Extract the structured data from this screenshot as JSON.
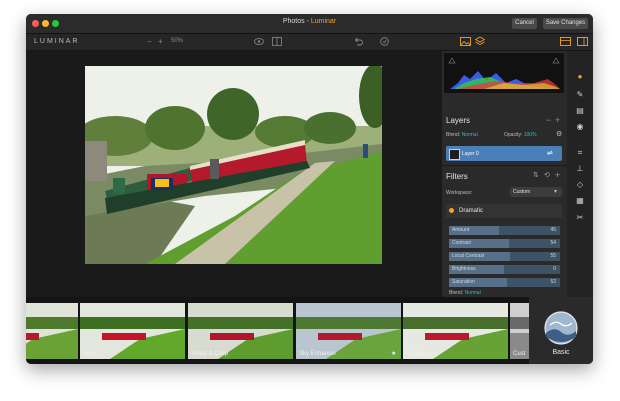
{
  "window": {
    "title_prefix": "Photos - ",
    "title_app": "Luminar",
    "cancel_label": "Cancel",
    "save_label": "Save Changes",
    "traffic_colors": [
      "#ff5f57",
      "#febc2e",
      "#28c840"
    ]
  },
  "toolbar": {
    "logo": "LUMINAR",
    "zoom_minus": "−",
    "zoom_plus": "+",
    "zoom": "50%"
  },
  "layers": {
    "title": "Layers",
    "blend_label": "Blend:",
    "blend_value": "Normal",
    "opacity_label": "Opacity:",
    "opacity_value": "100%",
    "layer_name": "Layer 0"
  },
  "filters": {
    "title": "Filters",
    "workspace_label": "Workspace:",
    "workspace_value": "Custom",
    "filter_name": "Dramatic",
    "sliders": [
      {
        "label": "Amount",
        "value": "45",
        "fill": 0.45
      },
      {
        "label": "Contrast",
        "value": "54",
        "fill": 0.54
      },
      {
        "label": "Local Contrast",
        "value": "55",
        "fill": 0.55
      },
      {
        "label": "Brightness",
        "value": "0",
        "fill": 0.5
      },
      {
        "label": "Saturation",
        "value": "52",
        "fill": 0.52
      }
    ],
    "blend_label": "Blend:",
    "blend_value": "Normal"
  },
  "presets": {
    "items": [
      {
        "label": "nces"
      },
      {
        "label": "Vivid"
      },
      {
        "label": "Sharp & Crisp"
      },
      {
        "label": "Sky Enhancer"
      },
      {
        "label": "Detailed"
      },
      {
        "label": "Cust"
      }
    ],
    "category": "Basic"
  },
  "colors": {
    "accent": "#f5a623",
    "selection": "#4a7fb8",
    "teal": "#39b6c8"
  }
}
